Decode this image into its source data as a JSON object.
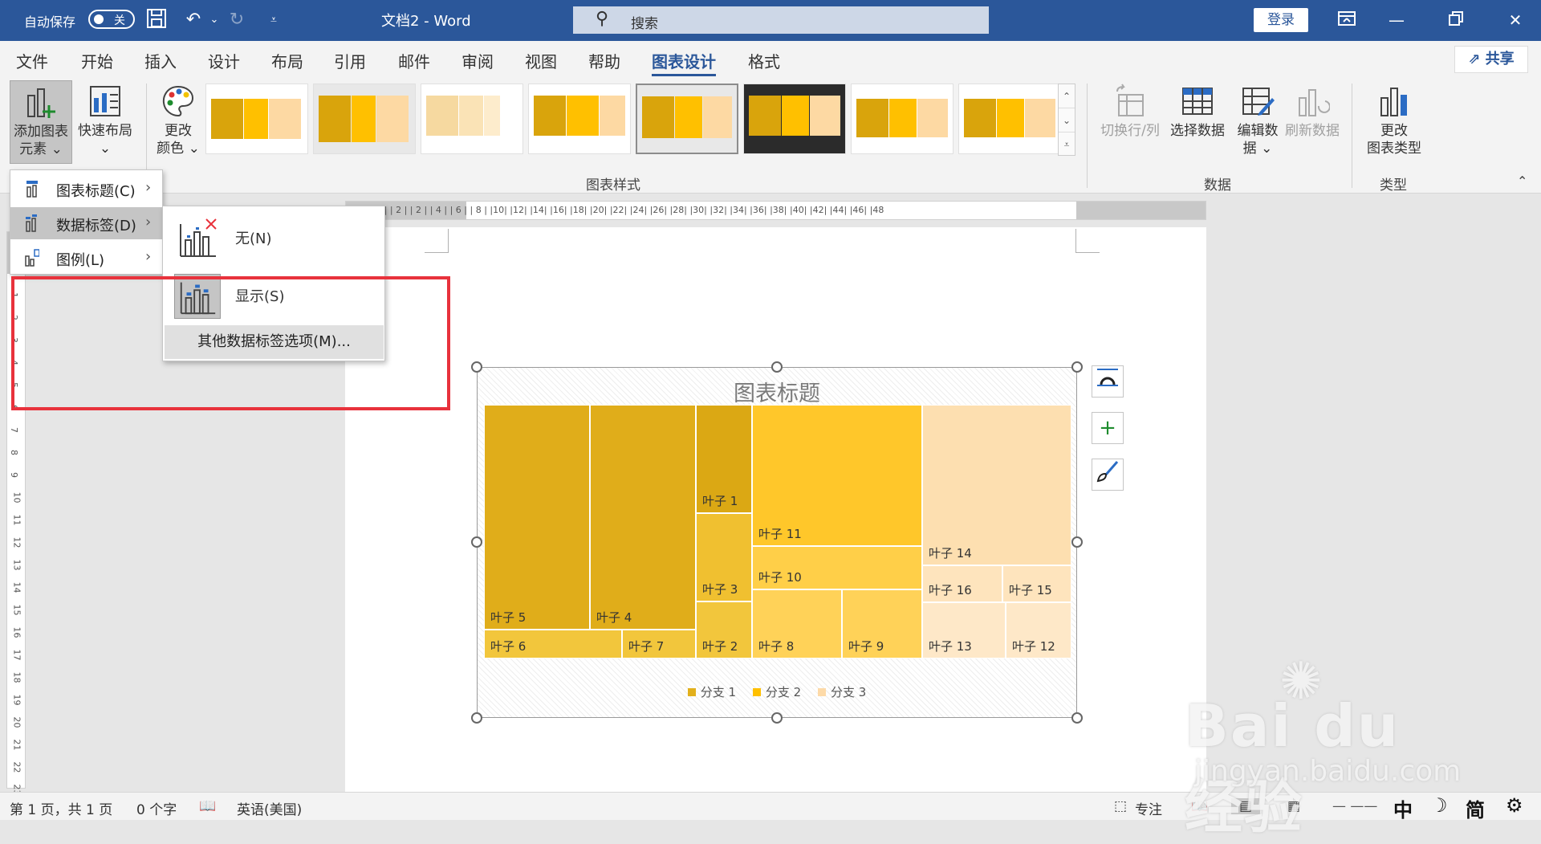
{
  "titlebar": {
    "autosave_label": "自动保存",
    "autosave_state": "关",
    "doc_title": "文档2 - Word",
    "search_placeholder": "搜索",
    "login_label": "登录"
  },
  "menu": {
    "items": [
      "文件",
      "开始",
      "插入",
      "设计",
      "布局",
      "引用",
      "邮件",
      "审阅",
      "视图",
      "帮助",
      "图表设计",
      "格式"
    ],
    "active": "图表设计",
    "share_label": "共享"
  },
  "ribbon": {
    "add_element": [
      "添加图表",
      "元素 ⌄"
    ],
    "quick_layout": [
      "快速布局",
      "⌄"
    ],
    "change_color": [
      "更改",
      "颜色 ⌄"
    ],
    "styles_group": "图表样式",
    "switch_row_col": "切换行/列",
    "select_data": "选择数据",
    "edit_data": [
      "编辑数",
      "据 ⌄"
    ],
    "refresh_data": "刷新数据",
    "data_group": "数据",
    "change_type": [
      "更改",
      "图表类型"
    ],
    "type_group": "类型"
  },
  "dropdown": {
    "items": [
      {
        "label": "图表标题(C)"
      },
      {
        "label": "数据标签(D)"
      },
      {
        "label": "图例(L)"
      }
    ]
  },
  "submenu": {
    "none_label": "无(N)",
    "show_label": "显示(S)",
    "more_label": "其他数据标签选项(M)..."
  },
  "ruler": {
    "h_labels": "| 4 |  | 2 |        | 2 |  | 4 |  | 6 |  | 8 |  |10|  |12|  |14|  |16|  |18|  |20|  |22|  |24|  |26|  |28|  |30|  |32|  |34|  |36|  |38|  |40|  |42|  |44|  |46|  |48",
    "v_labels": [
      "1",
      "1",
      "2",
      "3",
      "4",
      "5",
      "6",
      "7",
      "8",
      "9",
      "10",
      "11",
      "12",
      "13",
      "14",
      "15",
      "16",
      "17",
      "18",
      "19",
      "20",
      "21",
      "22",
      "23"
    ]
  },
  "chart": {
    "title": "图表标题",
    "tiles": [
      {
        "label": "分支 1",
        "color": "#d6a20a"
      },
      {
        "label": "叶子 5",
        "color": "#e0ad1a"
      },
      {
        "label": "叶子 4",
        "color": "#e0ad1a"
      },
      {
        "label": "叶子 1",
        "color": "#dba814"
      },
      {
        "label": "叶子 3",
        "color": "#f0c030"
      },
      {
        "label": "叶子 2",
        "color": "#f2c63c"
      },
      {
        "label": "叶子 6",
        "color": "#f2c63c"
      },
      {
        "label": "叶子 7",
        "color": "#f2c63c"
      },
      {
        "label": "分支 2",
        "color": "#ffc000"
      },
      {
        "label": "叶子 11",
        "color": "#ffc72a"
      },
      {
        "label": "叶子 10",
        "color": "#ffcf48"
      },
      {
        "label": "叶子 8",
        "color": "#ffd258"
      },
      {
        "label": "叶子 9",
        "color": "#ffd258"
      },
      {
        "label": "分支 3",
        "color": "#fdd9a3"
      },
      {
        "label": "叶子 14",
        "color": "#fddfb0"
      },
      {
        "label": "叶子 16",
        "color": "#fee4bd"
      },
      {
        "label": "叶子 15",
        "color": "#fee4bd"
      },
      {
        "label": "叶子 13",
        "color": "#fee8c8"
      },
      {
        "label": "叶子 12",
        "color": "#fee8c8"
      }
    ],
    "legend": [
      {
        "label": "分支 1",
        "color": "#e2b01c"
      },
      {
        "label": "分支 2",
        "color": "#ffc000"
      },
      {
        "label": "分支 3",
        "color": "#fddaa8"
      }
    ]
  },
  "statusbar": {
    "page": "第 1 页，共 1 页",
    "words": "0 个字",
    "language": "英语(美国)",
    "focus": "专注",
    "ime_zh": "中",
    "ime_simp": "简"
  },
  "watermark": {
    "brand": "Bai du 经验",
    "url": "jingyan.baidu.com"
  },
  "colors": {
    "titlebar": "#2b579a",
    "highlight": "#e8323c"
  }
}
